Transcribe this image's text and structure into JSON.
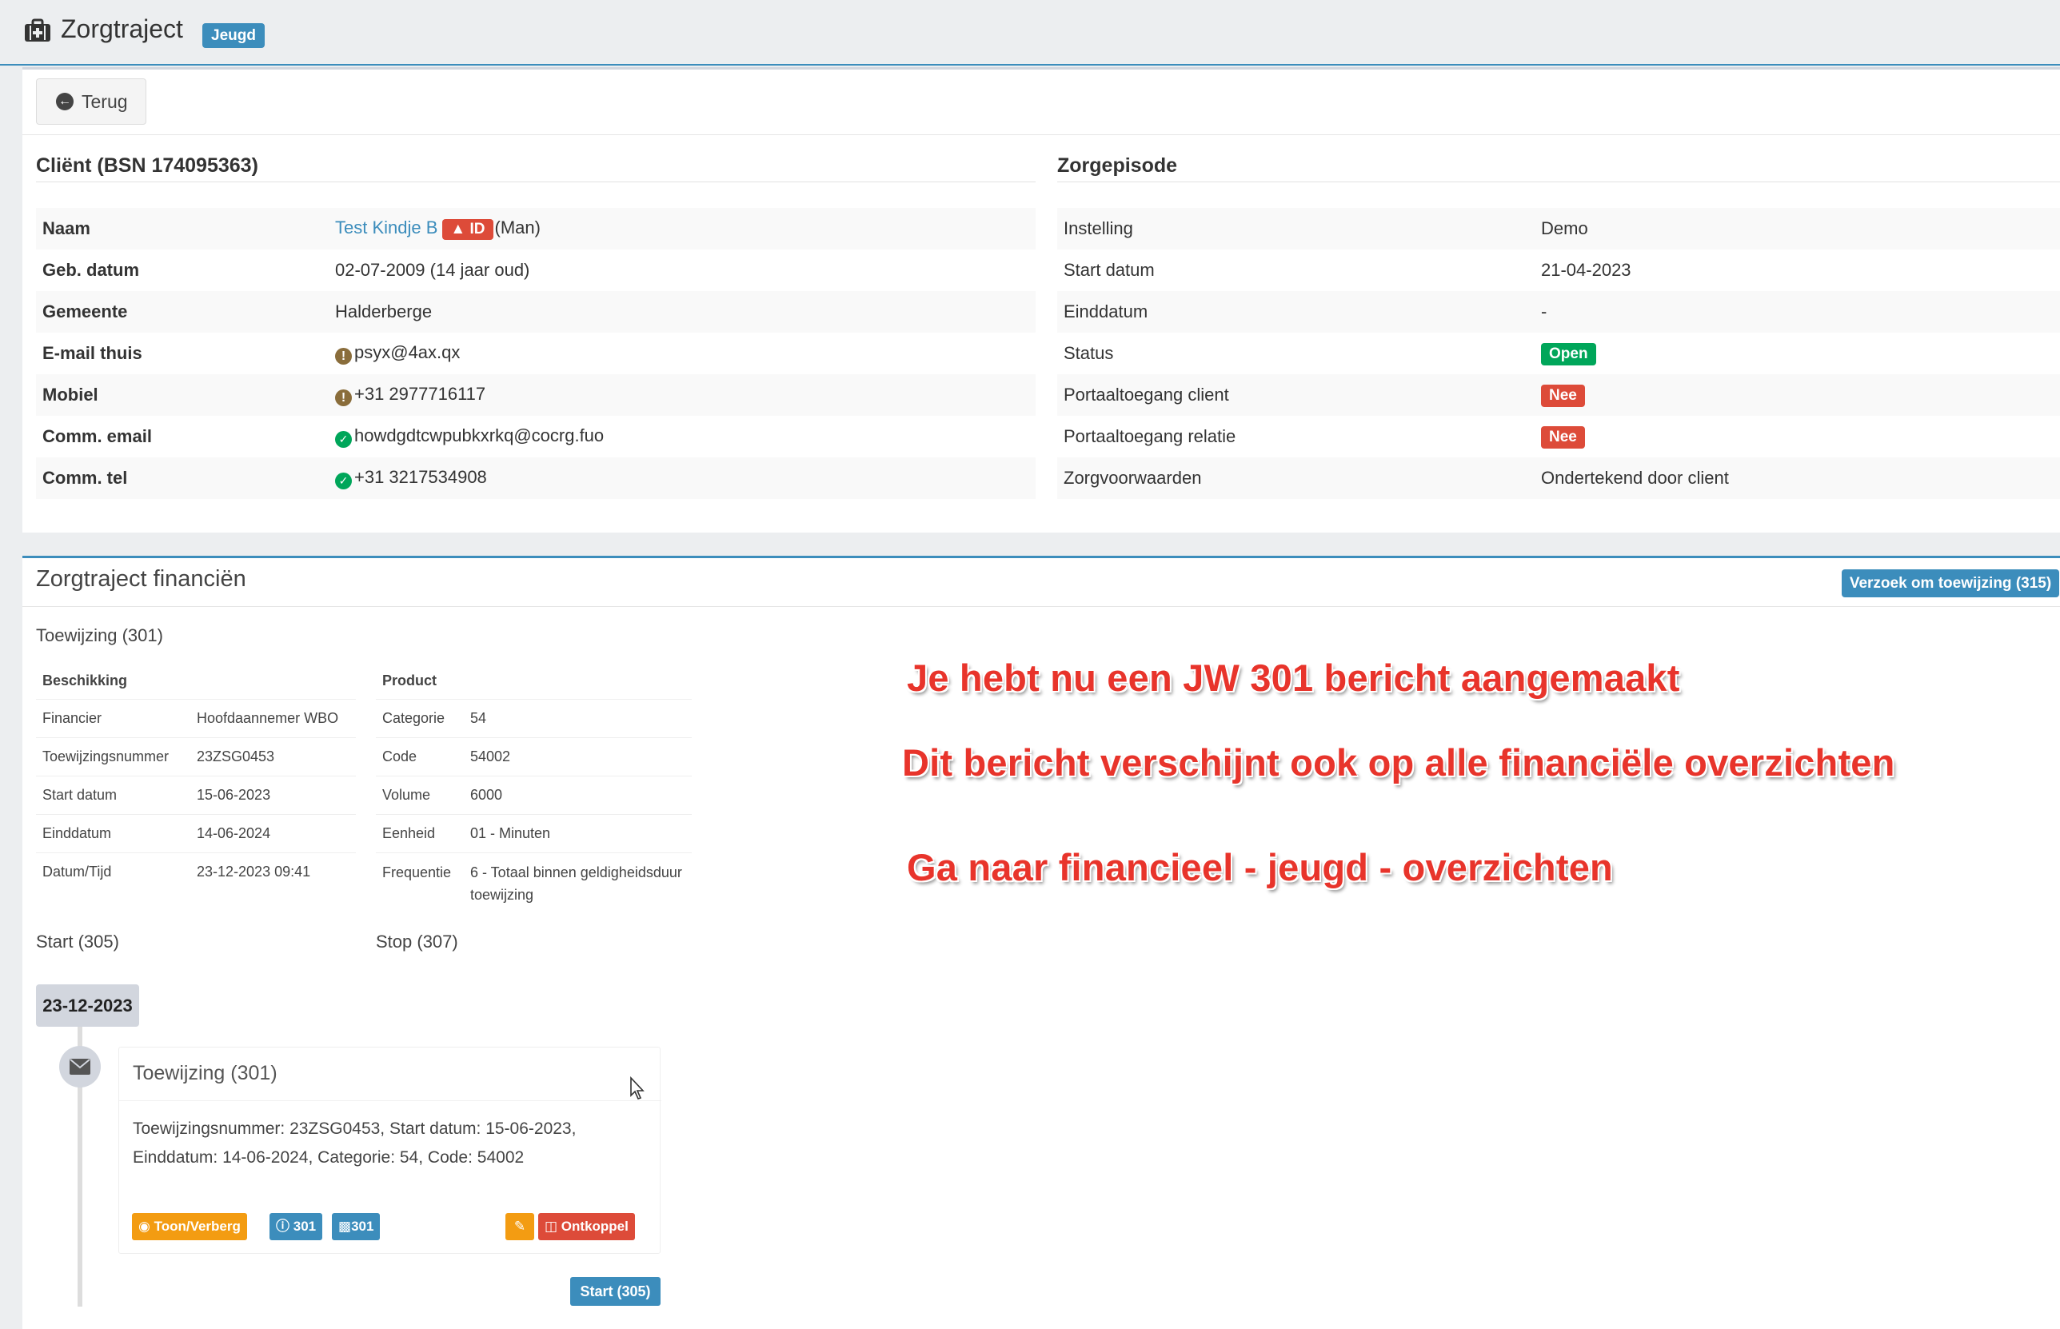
{
  "header": {
    "title": "Zorgtraject",
    "badge": "Jeugd"
  },
  "toolbar": {
    "back_label": "Terug"
  },
  "client": {
    "title": "Cliënt (BSN 174095363)",
    "rows": [
      {
        "label": "Naam",
        "value": "Test Kindje B",
        "badge": "ID",
        "suffix": "(Man)"
      },
      {
        "label": "Geb. datum",
        "value": "02-07-2009 (14 jaar oud)"
      },
      {
        "label": "Gemeente",
        "value": "Halderberge"
      },
      {
        "label": "E-mail thuis",
        "value": "psyx@4ax.qx",
        "icon": "warning-icon"
      },
      {
        "label": "Mobiel",
        "value": "+31 2977716117",
        "icon": "warning-icon"
      },
      {
        "label": "Comm. email",
        "value": "howdgdtcwpubkxrkq@cocrg.fuo",
        "icon": "check-icon"
      },
      {
        "label": "Comm. tel",
        "value": "+31 3217534908",
        "icon": "check-icon"
      }
    ]
  },
  "episode": {
    "title": "Zorgepisode",
    "rows": [
      {
        "label": "Instelling",
        "value": "Demo"
      },
      {
        "label": "Start datum",
        "value": "21-04-2023"
      },
      {
        "label": "Einddatum",
        "value": "-"
      },
      {
        "label": "Status",
        "value": "Open",
        "color": "#00a65a"
      },
      {
        "label": "Portaaltoegang client",
        "value": "Nee",
        "color": "#dd4b39"
      },
      {
        "label": "Portaaltoegang relatie",
        "value": "Nee",
        "color": "#dd4b39"
      },
      {
        "label": "Zorgvoorwaarden",
        "value": "Ondertekend door client"
      }
    ]
  },
  "finance": {
    "title": "Zorgtraject financiën",
    "request_button": "Verzoek om toewijzing (315)",
    "toewijzing_head": "Toewijzing (301)",
    "beschikking": {
      "header": "Beschikking",
      "rows": [
        {
          "k": "Financier",
          "v": "Hoofdaannemer WBO"
        },
        {
          "k": "Toewijzingsnummer",
          "v": "23ZSG0453"
        },
        {
          "k": "Start datum",
          "v": "15-06-2023"
        },
        {
          "k": "Einddatum",
          "v": "14-06-2024"
        },
        {
          "k": "Datum/Tijd",
          "v": "23-12-2023 09:41"
        }
      ]
    },
    "product": {
      "header": "Product",
      "rows": [
        {
          "k": "Categorie",
          "v": "54"
        },
        {
          "k": "Code",
          "v": "54002"
        },
        {
          "k": "Volume",
          "v": "6000"
        },
        {
          "k": "Eenheid",
          "v": "01 - Minuten"
        },
        {
          "k": "Frequentie",
          "v": "6 - Totaal binnen geldigheidsduur toewijzing"
        }
      ]
    },
    "start_label": "Start (305)",
    "stop_label": "Stop (307)"
  },
  "timeline": {
    "date": "23-12-2023",
    "item_title": "Toewijzing (301)",
    "item_body": "Toewijzingsnummer: 23ZSG0453, Start datum: 15-06-2023, Einddatum: 14-06-2024, Categorie: 54, Code: 54002",
    "btn_toggle": "Toon/Verberg",
    "btn_info": "301",
    "btn_pdf": "301",
    "btn_unlink": "Ontkoppel",
    "btn_start": "Start (305)"
  },
  "annotations": [
    "Je hebt nu een JW 301 bericht aangemaakt",
    "Dit bericht verschijnt ook op alle financiële overzichten",
    "Ga naar financieel - jeugd - overzichten"
  ]
}
